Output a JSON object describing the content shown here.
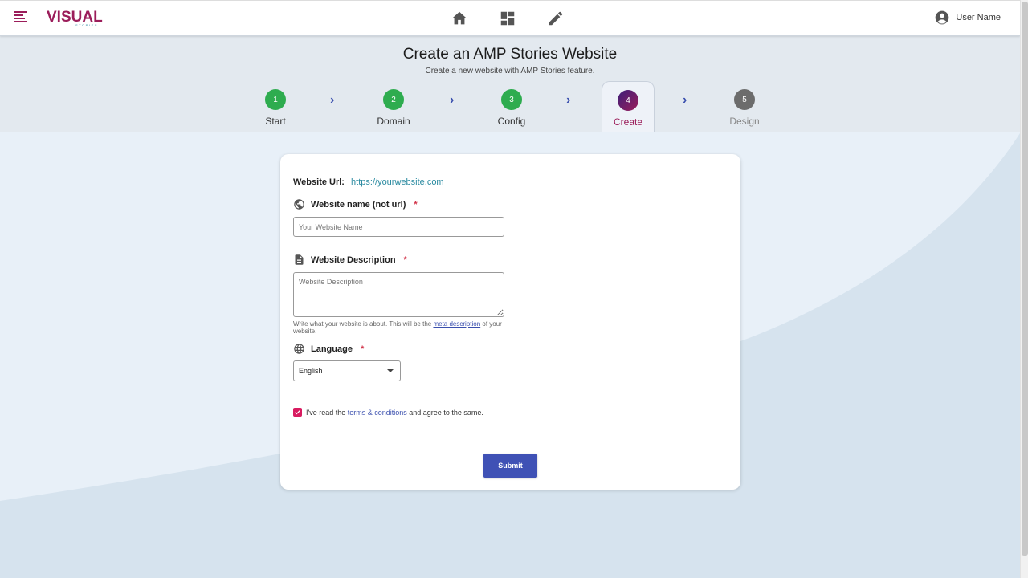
{
  "nav": {
    "logo_text": "VISUAL",
    "logo_subtext": "STORIES",
    "icons": [
      "home-icon",
      "dashboard-icon",
      "pencil-icon"
    ],
    "user_name": "User Name"
  },
  "header": {
    "title": "Create an AMP Stories Website",
    "subtitle": "Create a new website with AMP Stories feature."
  },
  "stepper": {
    "steps": [
      {
        "number": "1",
        "label": "Start",
        "state": "done"
      },
      {
        "number": "2",
        "label": "Domain",
        "state": "done"
      },
      {
        "number": "3",
        "label": "Config",
        "state": "done"
      },
      {
        "number": "4",
        "label": "Create",
        "state": "active"
      },
      {
        "number": "5",
        "label": "Design",
        "state": "todo"
      }
    ],
    "chevron": "›"
  },
  "form": {
    "url_label": "Website Url:",
    "url_value": "https://yourwebsite.com",
    "name_label": "Website name (not url)",
    "name_placeholder": "Your Website Name",
    "description_label": "Website Description",
    "description_placeholder": "Website Description",
    "helper_text_before": "Write what your website is about. This will be the ",
    "helper_link": "meta description",
    "helper_text_after": " of your website.",
    "language_label": "Language",
    "language_value": "English",
    "required_mark": "*",
    "terms_before": "I've read the ",
    "terms_link": "terms & conditions",
    "terms_after": " and agree to the same.",
    "terms_checked": true,
    "submit_label": "Submit"
  },
  "colors": {
    "brand": "#9b1d5a",
    "primary": "#3f51b5",
    "success": "#2eac4f",
    "link": "#2a8aa0",
    "checkbox": "#d81b60"
  }
}
